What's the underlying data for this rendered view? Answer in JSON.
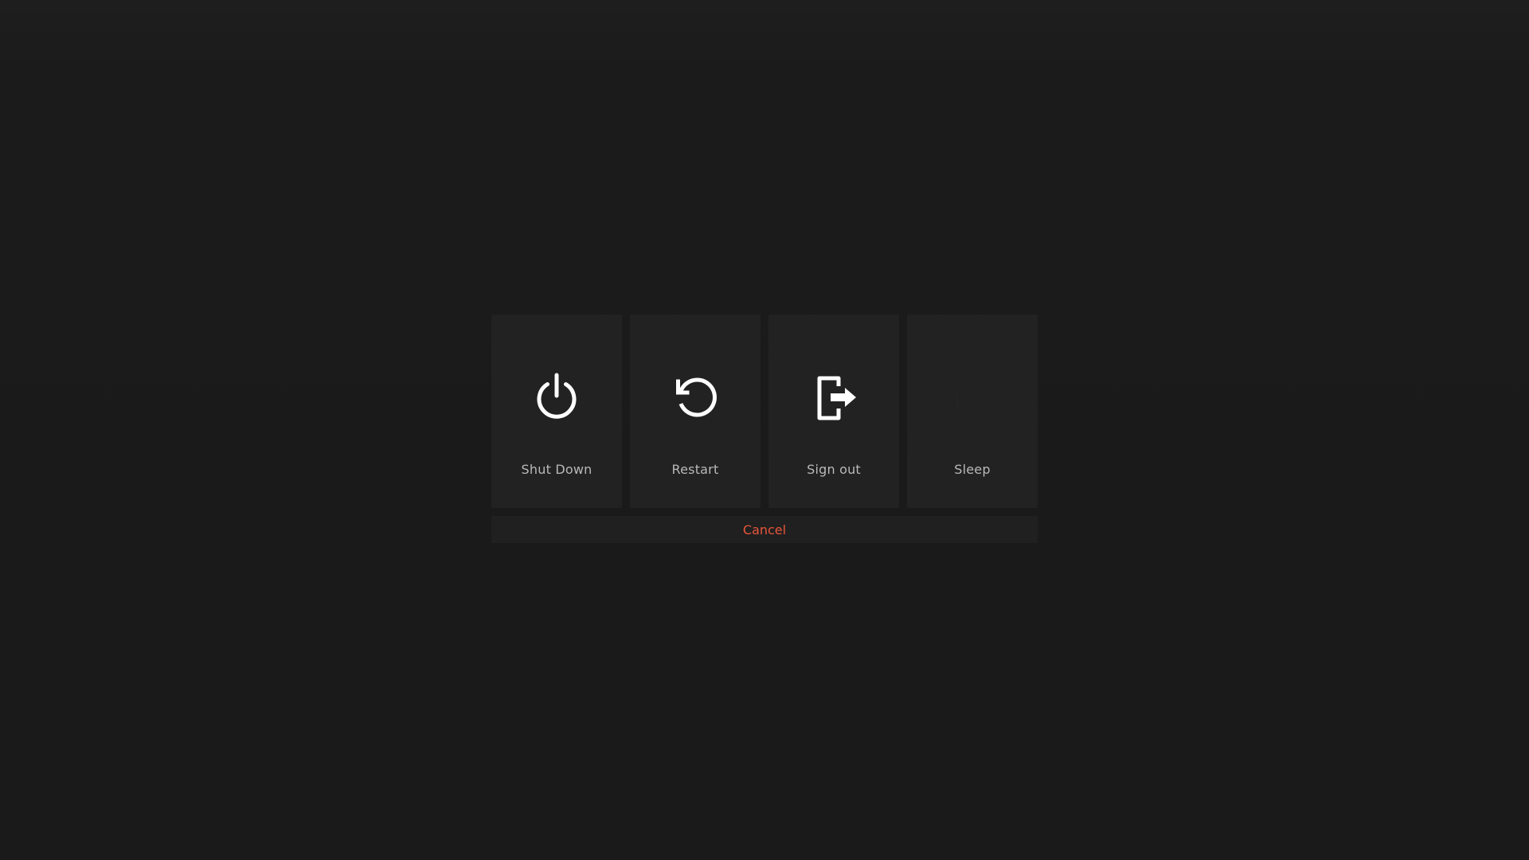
{
  "power_menu": {
    "options": [
      {
        "label": "Shut Down",
        "icon": "power-icon"
      },
      {
        "label": "Restart",
        "icon": "restart-icon"
      },
      {
        "label": "Sign out",
        "icon": "sign-out-icon"
      },
      {
        "label": "Sleep",
        "icon": "moon-icon"
      }
    ],
    "cancel_label": "Cancel"
  },
  "colors": {
    "background": "#1b1b1b",
    "tile": "#222222",
    "label": "#b9b9b9",
    "icon": "#ffffff",
    "cancel": "#e8553a"
  }
}
